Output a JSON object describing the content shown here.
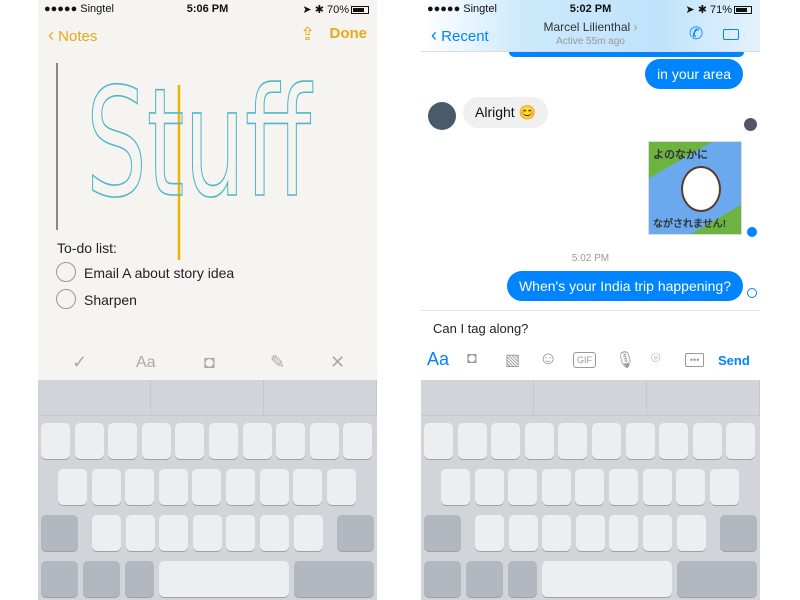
{
  "notes": {
    "status": {
      "carrier": "●●●●● Singtel",
      "time": "5:06 PM",
      "battery": "70%",
      "battery_level": 0.7
    },
    "back_label": "Notes",
    "done_label": "Done",
    "handwriting": "Stuff",
    "todo_title": "To-do list:",
    "todos": [
      {
        "label": "Email A about story idea",
        "checked": false
      },
      {
        "label": "Sharpen",
        "checked": false
      }
    ],
    "toolbar": [
      "check-icon",
      "text-format-icon",
      "camera-icon",
      "sketch-icon",
      "close-icon"
    ],
    "toolbar_text": "Aa",
    "accent": "#e8a817"
  },
  "messenger": {
    "status": {
      "carrier": "●●●●● Singtel",
      "time": "5:02 PM",
      "battery": "71%",
      "battery_level": 0.71
    },
    "back_label": "Recent",
    "contact": "Marcel Lilienthal",
    "active": "Active 55m ago",
    "messages": [
      {
        "from": "me",
        "text": "in your area"
      },
      {
        "from": "them",
        "text": "Alright 😊"
      },
      {
        "from": "me",
        "type": "sticker",
        "sticker_text": [
          "よのなかに",
          "ながされません!"
        ]
      },
      {
        "timestamp": "5:02 PM"
      },
      {
        "from": "me",
        "text": "When's your India trip happening?"
      }
    ],
    "input_value": "Can I tag along?",
    "composer": {
      "aa": "Aa",
      "gif": "GIF",
      "send": "Send"
    },
    "accent": "#0084ff"
  }
}
